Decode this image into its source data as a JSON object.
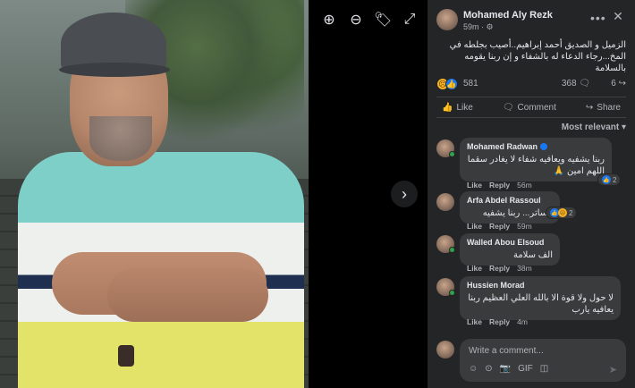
{
  "viewer": {
    "toolbar": [
      {
        "name": "zoom-in-icon",
        "glyph": "⊕"
      },
      {
        "name": "zoom-out-icon",
        "glyph": "⊖"
      },
      {
        "name": "tag-icon",
        "glyph": "🏷"
      },
      {
        "name": "fullscreen-icon",
        "glyph": "⤢"
      }
    ],
    "next_glyph": "›"
  },
  "post": {
    "author": "Mohamed Aly Rezk",
    "time": "59m ·",
    "privacy_glyph": "⚙",
    "more_glyph": "•••",
    "close_glyph": "✕",
    "text": "الزميل و الصديق أحمد إبراهيم..أصيب بجلطه في المخ...رجاء الدعاء له بالشفاء و إن ربنا يقومه بالسلامة",
    "reactions_count": "581",
    "comments_count": "368",
    "shares_count": "6",
    "comment_glyph": "🗨",
    "share_glyph": "↪"
  },
  "actions": {
    "like": "Like",
    "comment": "Comment",
    "share": "Share"
  },
  "sort_label": "Most relevant ▾",
  "comments": [
    {
      "name": "Mohamed Radwan",
      "verified": true,
      "text": "ربنا يشفيه ويعافيه شفاء لا يغادر سقما اللهم امين 🙏",
      "time": "56m",
      "react_count": "2"
    },
    {
      "name": "Arfa Abdel Rassoul",
      "verified": false,
      "text": "ياساتر... ربنا يشفيه",
      "time": "59m",
      "react_count": "2"
    },
    {
      "name": "Walled Abou Elsoud",
      "verified": false,
      "text": "الف سلامة",
      "time": "38m",
      "react_count": ""
    },
    {
      "name": "Hussien Morad",
      "verified": false,
      "text": "لا حول ولا قوة الا بالله العلي العظيم ربنا يعافيه يارب",
      "time": "4m",
      "react_count": ""
    }
  ],
  "comment_actions": {
    "like": "Like",
    "reply": "Reply"
  },
  "composer": {
    "placeholder": "Write a comment...",
    "tools": [
      "☺",
      "⊙",
      "📷",
      "GIF",
      "◫"
    ],
    "send_glyph": "➤"
  }
}
